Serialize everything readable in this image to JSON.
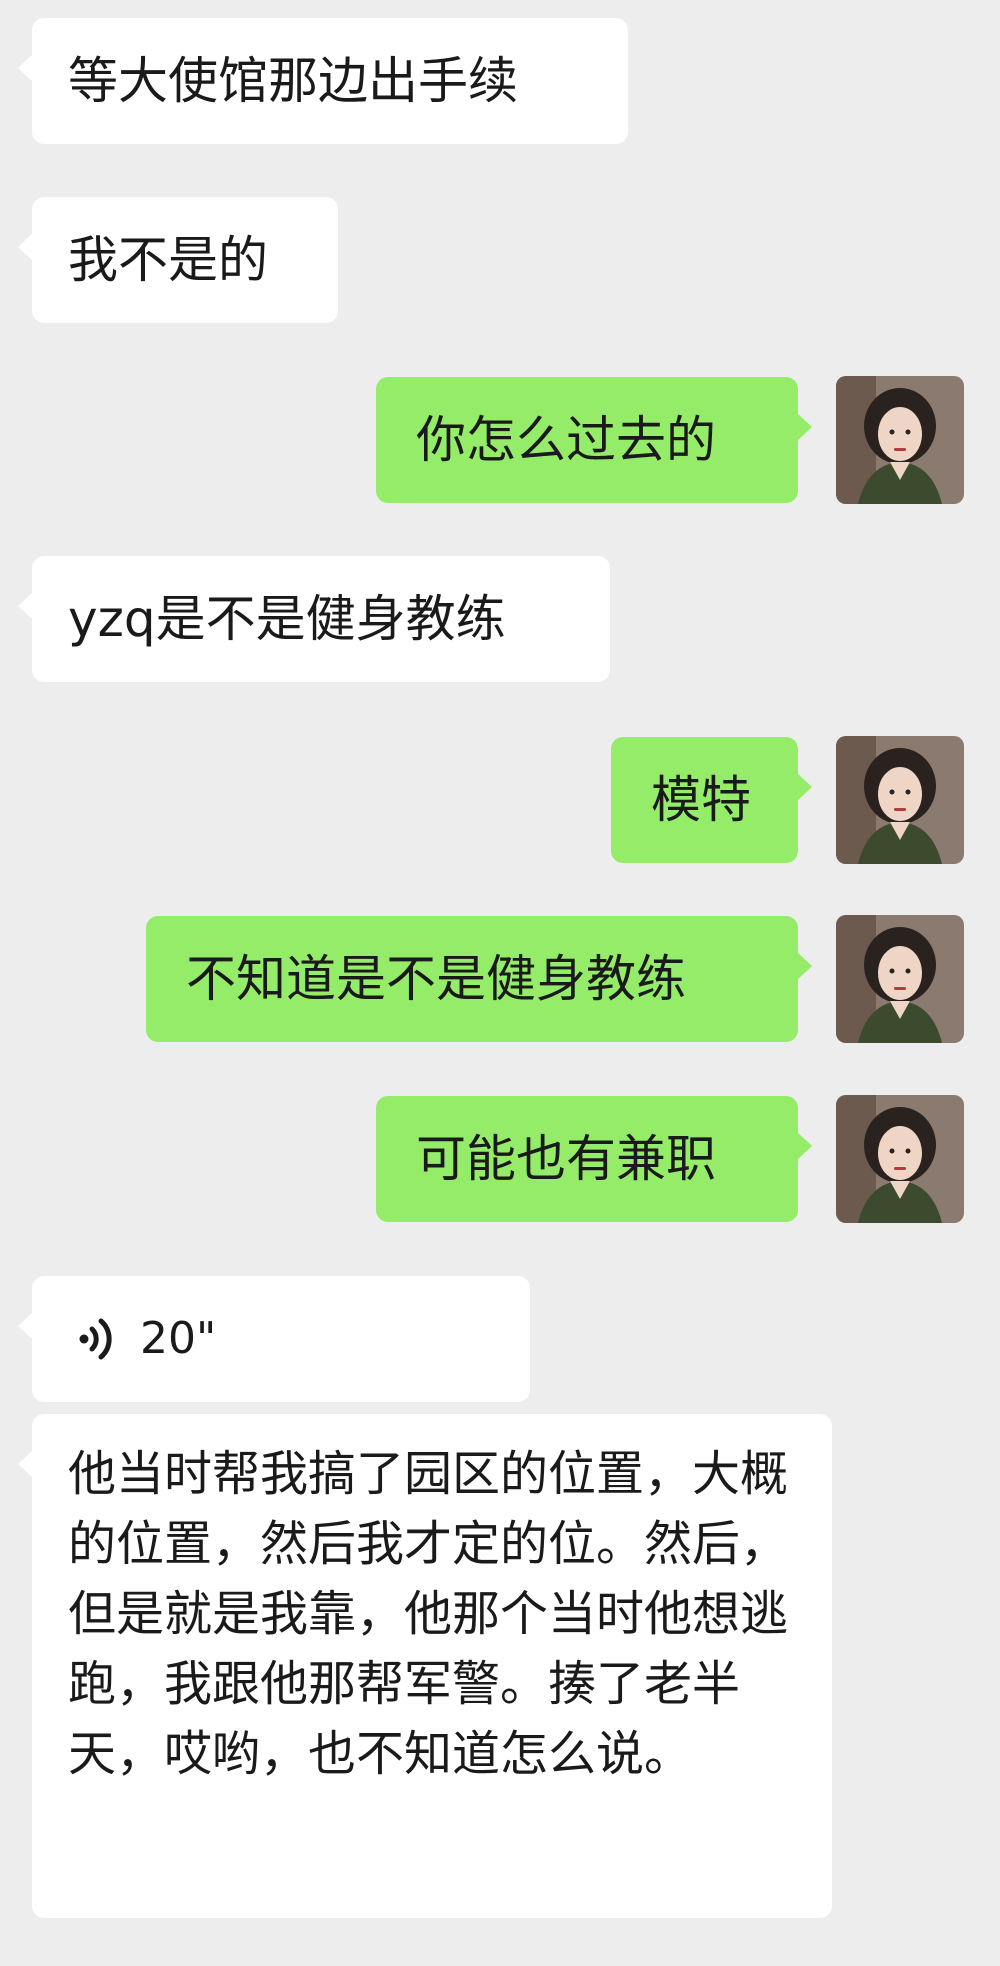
{
  "colors": {
    "background": "#ededed",
    "incoming_bubble": "#ffffff",
    "outgoing_bubble": "#95ec69",
    "text": "#1a1a1a"
  },
  "icons": {
    "voice": "voice-wave-icon",
    "avatar": "user-avatar-photo"
  },
  "messages": [
    {
      "side": "in",
      "type": "text",
      "text": "等大使馆那边出手续"
    },
    {
      "side": "in",
      "type": "text",
      "text": "我不是的"
    },
    {
      "side": "out",
      "type": "text",
      "text": "你怎么过去的"
    },
    {
      "side": "in",
      "type": "text",
      "text": "yzq是不是健身教练"
    },
    {
      "side": "out",
      "type": "text",
      "text": "模特"
    },
    {
      "side": "out",
      "type": "text",
      "text": "不知道是不是健身教练"
    },
    {
      "side": "out",
      "type": "text",
      "text": "可能也有兼职"
    },
    {
      "side": "in",
      "type": "voice",
      "duration": "20\""
    },
    {
      "side": "in",
      "type": "text",
      "text": "他当时帮我搞了园区的位置，大概的位置，然后我才定的位。然后，但是就是我靠，他那个当时他想逃跑，我跟他那帮军警。揍了老半天，哎哟，也不知道怎么说。"
    }
  ]
}
